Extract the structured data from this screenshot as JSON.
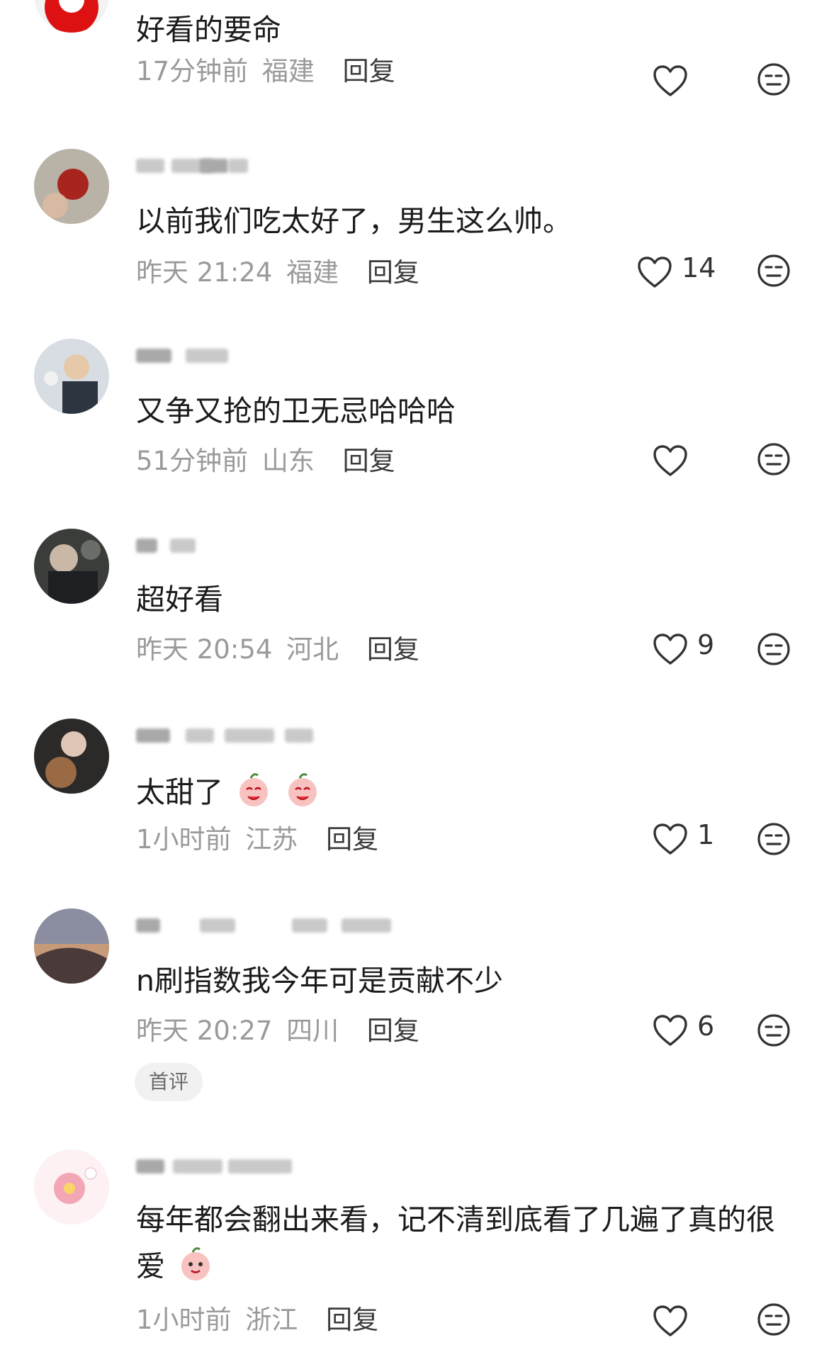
{
  "comments": [
    {
      "text": "好看的要命",
      "time": "17分钟前",
      "location": "福建",
      "reply": "回复",
      "likes": ""
    },
    {
      "username": "淡冥",
      "text": "以前我们吃太好了，男生这么帅。",
      "time": "昨天 21:24",
      "location": "福建",
      "reply": "回复",
      "likes": "14"
    },
    {
      "username": "m",
      "text": "又争又抢的卫无忌哈哈哈",
      "time": "51分钟前",
      "location": "山东",
      "reply": "回复",
      "likes": ""
    },
    {
      "text": "超好看",
      "time": "昨天 20:54",
      "location": "河北",
      "reply": "回复",
      "likes": "9"
    },
    {
      "username": "bu",
      "text": "太甜了",
      "time": "1小时前",
      "location": "江苏",
      "reply": "回复",
      "likes": "1"
    },
    {
      "text": "n刷指数我今年可是贡献不少",
      "time": "昨天 20:27",
      "location": "四川",
      "reply": "回复",
      "likes": "6",
      "badge": "首评"
    },
    {
      "text": "每年都会翻出来看，记不清到底看了几遍了真的很爱",
      "time": "1小时前",
      "location": "浙江",
      "reply": "回复",
      "likes": ""
    }
  ],
  "icons": {
    "like": "heart-outline-icon",
    "dislike": "meh-face-icon",
    "emoji": "peach-emoji-icon"
  },
  "colors": {
    "text": "#1b1b1b",
    "meta": "#9a9a9a",
    "icon": "#333333"
  }
}
